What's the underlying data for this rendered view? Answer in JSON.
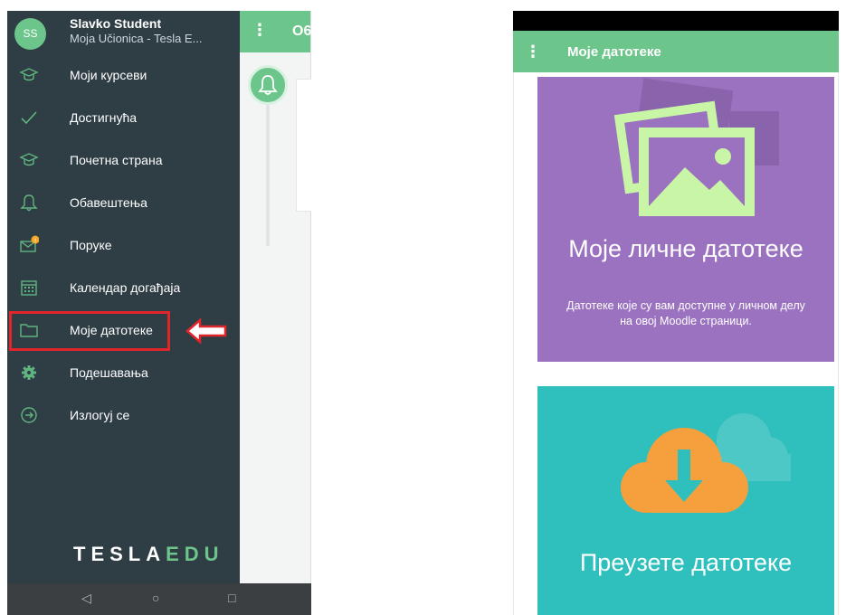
{
  "left_screen": {
    "drawer": {
      "avatar_initials": "SS",
      "user_name": "Slavko Student",
      "site_name": "Moja Učionica - Tesla E...",
      "menu_items": [
        {
          "label": "Моји курсеви",
          "icon": "mortarboard-icon"
        },
        {
          "label": "Достигнућа",
          "icon": "checkmark-icon"
        },
        {
          "label": "Почетна страна",
          "icon": "mortarboard-icon"
        },
        {
          "label": "Обавештења",
          "icon": "bell-icon"
        },
        {
          "label": "Поруке",
          "icon": "envelope-icon",
          "badge": "!"
        },
        {
          "label": "Календар догађаја",
          "icon": "calendar-icon"
        },
        {
          "label": "Моје датотеке",
          "icon": "folder-icon",
          "highlighted": true
        },
        {
          "label": "Подешавања",
          "icon": "gear-icon"
        },
        {
          "label": "Излогуј се",
          "icon": "logout-icon"
        }
      ],
      "logo_main": "TESLA",
      "logo_accent": "EDU"
    },
    "behind_appbar_title": "О6"
  },
  "right_screen": {
    "appbar_title": "Моје датотеке",
    "cards": [
      {
        "title": "Моје личне датотеке",
        "description": "Датотеке које су вам доступне у личном делу на овој Moodle страници.",
        "icon": "images-icon",
        "color": "#9a72bf"
      },
      {
        "title": "Преузете датотеке",
        "icon": "cloud-download-icon",
        "color": "#2fbfbd"
      }
    ]
  },
  "colors": {
    "accent": "#6cc58b",
    "drawer_bg": "#2f3d45",
    "highlight": "#e0262b"
  }
}
